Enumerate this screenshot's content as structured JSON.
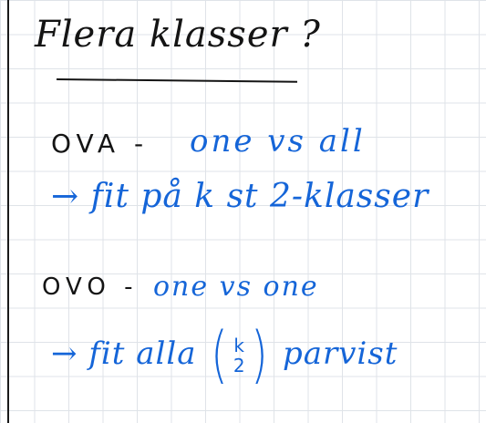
{
  "title": "Flera klasser ?",
  "ova": {
    "abbr": "OVA -",
    "desc": "one vs all",
    "detail": "→ fit på k st 2-klasser"
  },
  "ovo": {
    "abbr": "OVO -",
    "desc": "one vs one",
    "detail_prefix": "→ fit alla",
    "binom_top": "k",
    "binom_bottom": "2",
    "detail_suffix": "parvist"
  },
  "colors": {
    "ink": "#141414",
    "blue_ink": "#1565d8",
    "grid": "#dfe3e8"
  }
}
